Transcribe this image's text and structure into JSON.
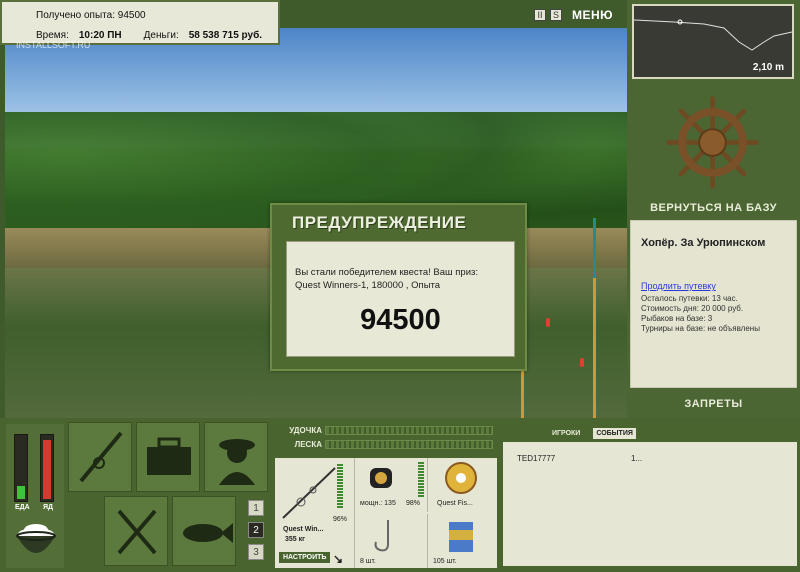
{
  "hud": {
    "experience_label": "Получено опыта:",
    "experience_value": "94500",
    "time_label": "Время:",
    "time_value": "10:20 ПН",
    "money_label": "Деньги:",
    "money_value": "58 538 715 руб.",
    "watermark": "INSTALLSOFT.RU"
  },
  "top_controls": {
    "pause_glyph": "II",
    "sound_glyph": "S",
    "menu_label": "МЕНЮ"
  },
  "depth_map": {
    "depth_value": "2,10 m"
  },
  "right_panel": {
    "return_label": "ВЕРНУТЬСЯ НА БАЗУ",
    "location_title": "Хопёр. За Урюпинском",
    "extend_link": "Продлить путевку",
    "lines": [
      "Осталось путевки: 13 час.",
      "Стоимость дня: 20 000 руб.",
      "Рыбаков на базе: 3",
      "Турниры на базе: не объявлены"
    ],
    "bans_label": "ЗАПРЕТЫ"
  },
  "dialog": {
    "title": "ПРЕДУПРЕЖДЕНИЕ",
    "message_line1": "Вы стали победителем квеста! Ваш приз:",
    "message_line2": "Quest Winners-1, 180000 , Опыта",
    "score": "94500"
  },
  "meters": {
    "food_label": "ЕДА",
    "poison_label": "ЯД",
    "food_level": 0.2,
    "poison_level": 0.9,
    "colors": {
      "food": "#3fc23a",
      "poison": "#d43a30"
    }
  },
  "tools_panel": {
    "slot_numbers": [
      "1",
      "2",
      "3"
    ],
    "active_slot": "2"
  },
  "gear_panel": {
    "rod_label": "УДОЧКА",
    "line_label": "ЛЕСКА",
    "rod_name": "Quest Win...",
    "rod_weight": "355 кг",
    "rod_percent": "96%",
    "reel_info": "мощн.: 135",
    "reel_percent": "98%",
    "line_name": "Quest Fis...",
    "hooks_count": "8 шт.",
    "bait_count": "105 шт.",
    "setup_label": "НАСТРОИТЬ"
  },
  "players_panel": {
    "tab_players": "ИГРОКИ",
    "tab_events": "СОБЫТИЯ",
    "player_name": "TED17777",
    "player_value": "1..."
  }
}
